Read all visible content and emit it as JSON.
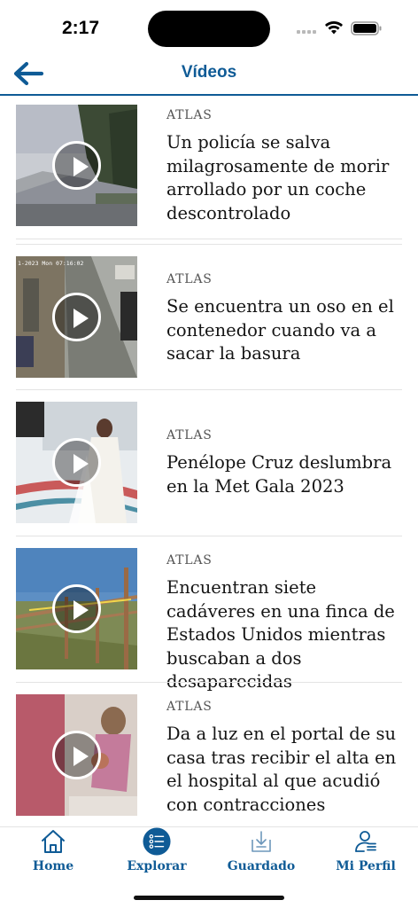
{
  "status_bar": {
    "time": "2:17"
  },
  "nav": {
    "title": "Vídeos"
  },
  "videos": [
    {
      "source": "ATLAS",
      "title": "Un policía se salva milagrosamente de morir arrollado por un coche descontrolado"
    },
    {
      "source": "ATLAS",
      "title": "Se encuentra un oso en el contenedor cuando va a sacar la basura"
    },
    {
      "source": "ATLAS",
      "title": "Penélope Cruz deslumbra en la Met Gala 2023"
    },
    {
      "source": "ATLAS",
      "title": "Encuentran siete cadáveres en una finca de Estados Unidos mientras buscaban a dos desaparecidas"
    },
    {
      "source": "ATLAS",
      "title": "Da a luz en el portal de su casa tras recibir el alta en el hospital al que acudió con contracciones"
    }
  ],
  "tab_bar": {
    "items": [
      {
        "label": "Home",
        "icon": "home-icon"
      },
      {
        "label": "Explorar",
        "icon": "explore-list-icon"
      },
      {
        "label": "Guardado",
        "icon": "saved-download-icon"
      },
      {
        "label": "Mi Perfil",
        "icon": "profile-icon"
      }
    ],
    "active": "Explorar"
  },
  "colors": {
    "brand": "#0f5b96",
    "text": "#141414",
    "source": "#555555"
  }
}
